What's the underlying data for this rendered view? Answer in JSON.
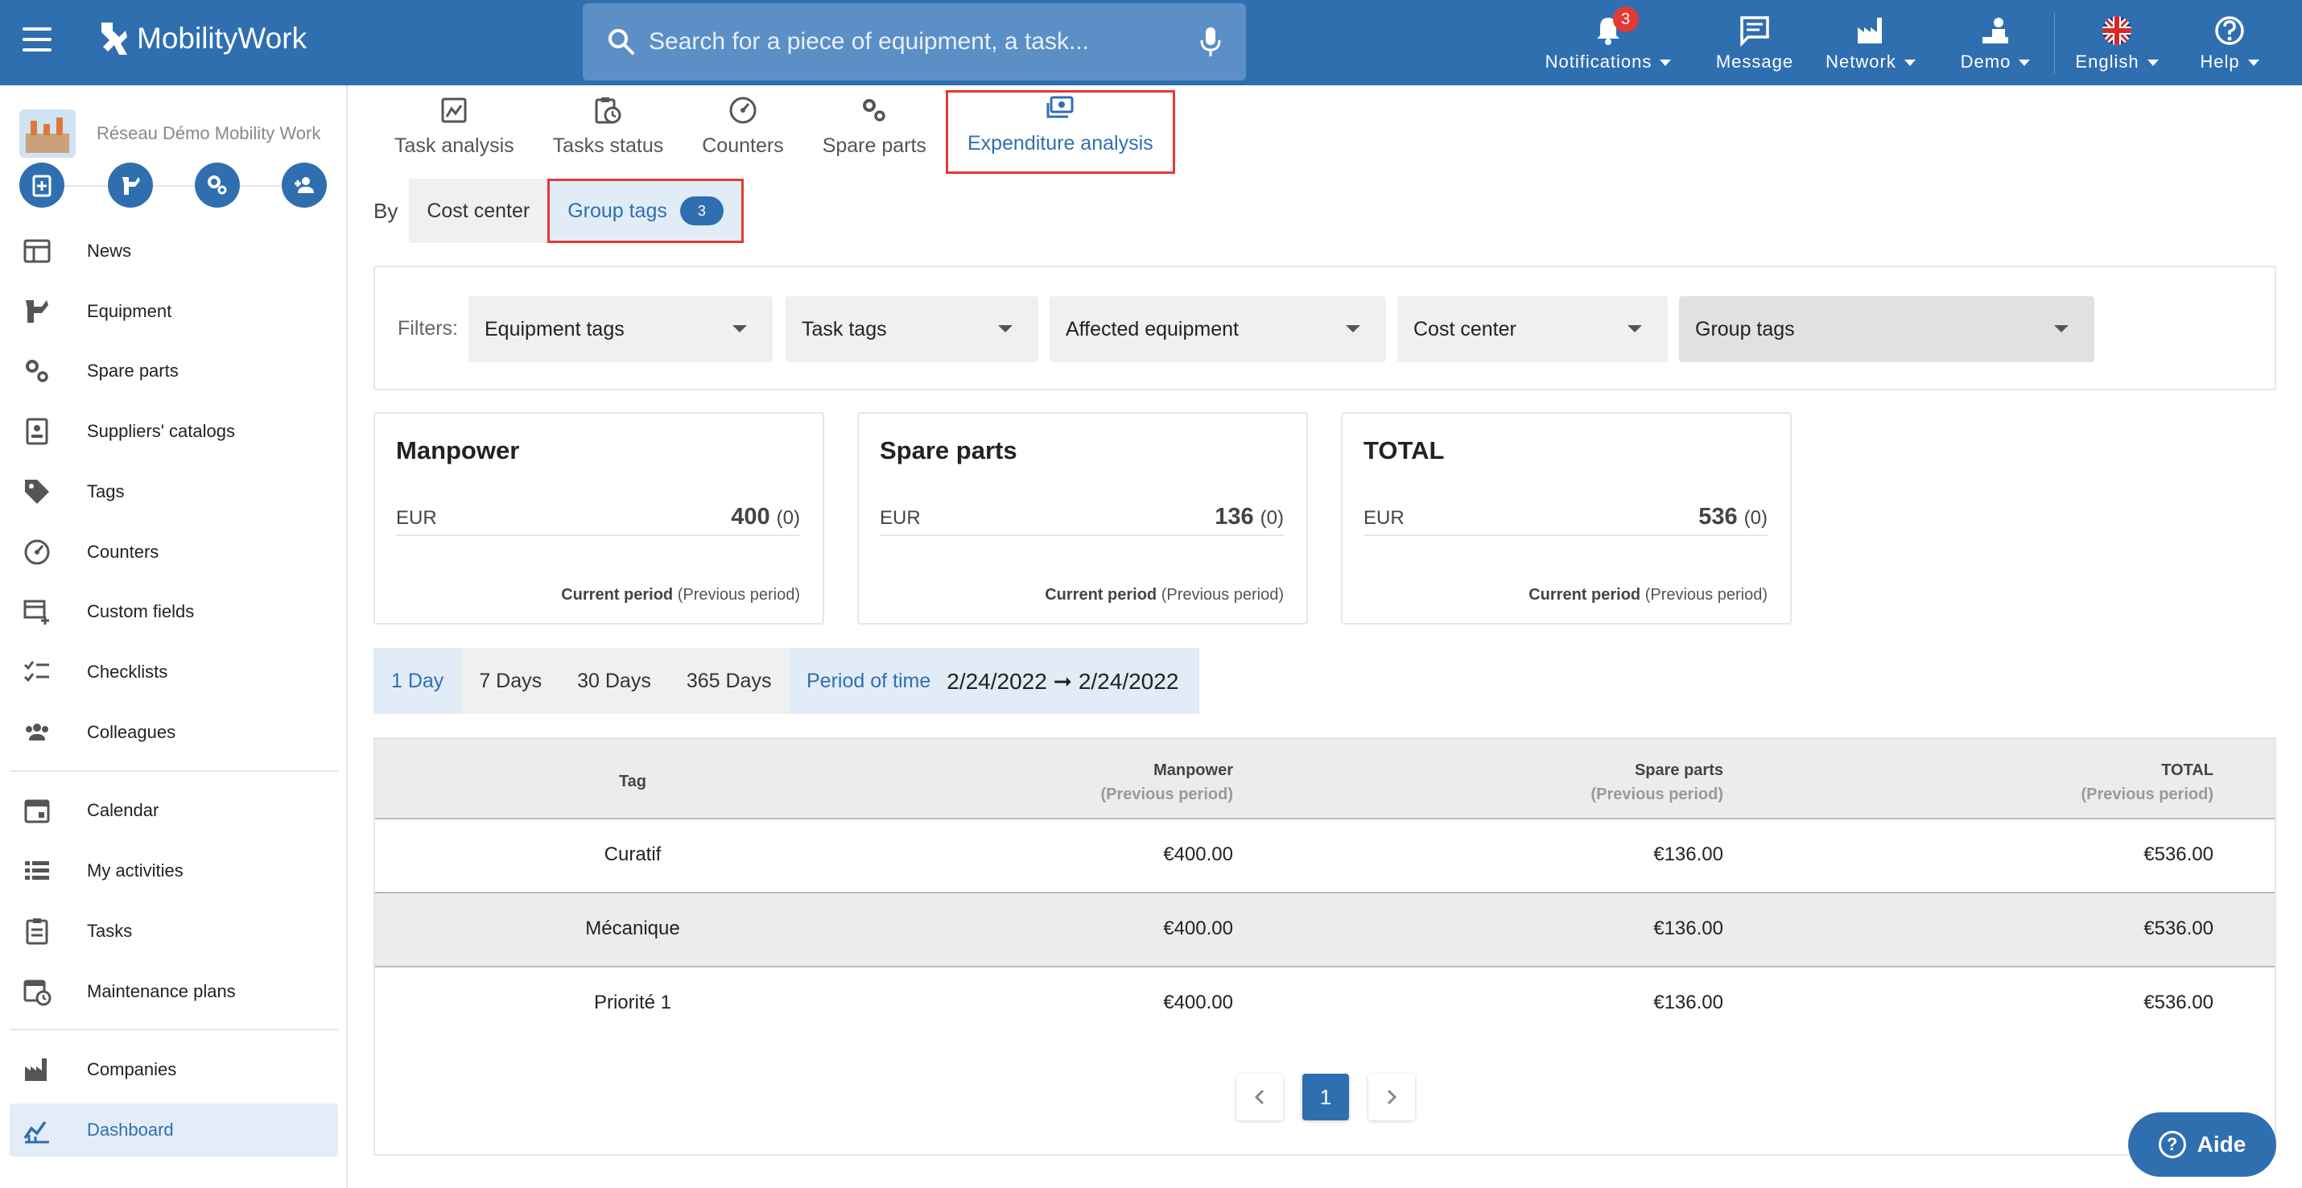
{
  "header": {
    "app_name": "MobilityWork",
    "search_placeholder": "Search for a piece of equipment, a task...",
    "nav": [
      {
        "label": "Notifications",
        "icon": "bell-icon",
        "badge": "3",
        "caret": true
      },
      {
        "label": "Message",
        "icon": "message-icon",
        "caret": false
      },
      {
        "label": "Network",
        "icon": "factory-icon",
        "caret": true
      },
      {
        "label": "Demo",
        "icon": "user-desk-icon",
        "caret": true
      },
      {
        "label": "English",
        "icon": "uk-flag-icon",
        "caret": true
      },
      {
        "label": "Help",
        "icon": "help-icon",
        "caret": true
      }
    ]
  },
  "sidebar": {
    "org_name": "Réseau Démo Mobility Work",
    "items": [
      {
        "label": "News",
        "icon": "news-icon"
      },
      {
        "label": "Equipment",
        "icon": "equipment-icon"
      },
      {
        "label": "Spare parts",
        "icon": "gears-icon"
      },
      {
        "label": "Suppliers' catalogs",
        "icon": "catalog-icon"
      },
      {
        "label": "Tags",
        "icon": "tag-icon"
      },
      {
        "label": "Counters",
        "icon": "gauge-icon"
      },
      {
        "label": "Custom fields",
        "icon": "custom-fields-icon"
      },
      {
        "label": "Checklists",
        "icon": "checklist-icon"
      },
      {
        "label": "Colleagues",
        "icon": "people-icon"
      },
      {
        "label": "Calendar",
        "icon": "calendar-icon"
      },
      {
        "label": "My activities",
        "icon": "list-icon"
      },
      {
        "label": "Tasks",
        "icon": "clipboard-icon"
      },
      {
        "label": "Maintenance plans",
        "icon": "calendar-clock-icon"
      },
      {
        "label": "Companies",
        "icon": "factory-icon"
      },
      {
        "label": "Dashboard",
        "icon": "chart-icon"
      }
    ]
  },
  "tabs": [
    {
      "label": "Task analysis",
      "icon": "image-chart-icon"
    },
    {
      "label": "Tasks status",
      "icon": "clipboard-clock-icon"
    },
    {
      "label": "Counters",
      "icon": "gauge-icon"
    },
    {
      "label": "Spare parts",
      "icon": "gears-icon"
    },
    {
      "label": "Expenditure analysis",
      "icon": "money-icon"
    }
  ],
  "by": {
    "label": "By",
    "options": [
      "Cost center",
      "Group tags"
    ],
    "group_tags_count": "3"
  },
  "filters": {
    "label": "Filters:",
    "selects": [
      "Equipment tags",
      "Task tags",
      "Affected equipment",
      "Cost center",
      "Group tags"
    ]
  },
  "cards": [
    {
      "title": "Manpower",
      "currency": "EUR",
      "value": "400",
      "previous": "(0)",
      "foot_current": "Current period",
      "foot_previous": "(Previous period)"
    },
    {
      "title": "Spare parts",
      "currency": "EUR",
      "value": "136",
      "previous": "(0)",
      "foot_current": "Current period",
      "foot_previous": "(Previous period)"
    },
    {
      "title": "TOTAL",
      "currency": "EUR",
      "value": "536",
      "previous": "(0)",
      "foot_current": "Current period",
      "foot_previous": "(Previous period)"
    }
  ],
  "periods": [
    "1 Day",
    "7 Days",
    "30 Days",
    "365 Days"
  ],
  "period_of_time": {
    "label": "Period of time",
    "value": "2/24/2022 ➞ 2/24/2022"
  },
  "table": {
    "headers": [
      {
        "title": "Tag",
        "sub": ""
      },
      {
        "title": "Manpower",
        "sub": "(Previous period)"
      },
      {
        "title": "Spare parts",
        "sub": "(Previous period)"
      },
      {
        "title": "TOTAL",
        "sub": "(Previous period)"
      }
    ],
    "rows": [
      [
        "Curatif",
        "€400.00",
        "€136.00",
        "€536.00"
      ],
      [
        "Mécanique",
        "€400.00",
        "€136.00",
        "€536.00"
      ],
      [
        "Priorité 1",
        "€400.00",
        "€136.00",
        "€536.00"
      ]
    ]
  },
  "pagination": {
    "current": "1"
  },
  "help_button": {
    "label": "Aide"
  },
  "colors": {
    "primary": "#2f6fb0",
    "highlight": "#e53935",
    "badge": "#e53935"
  }
}
